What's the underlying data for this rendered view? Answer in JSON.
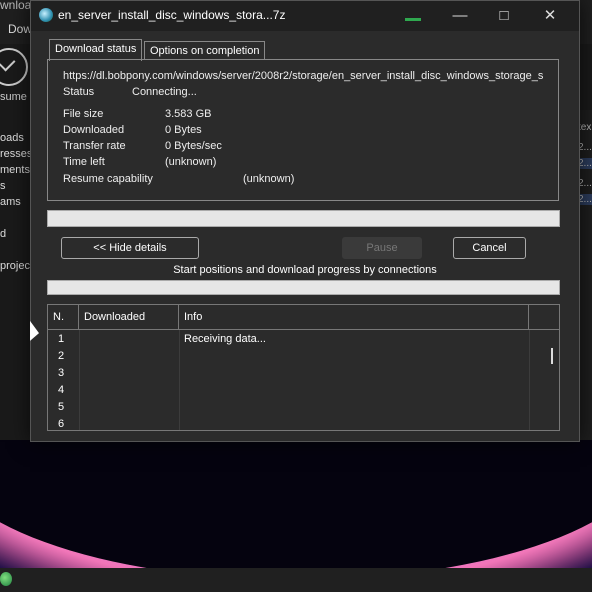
{
  "background_app": {
    "title_fragment": "wnload",
    "menu_fragment": "Dow",
    "resume_label": "sume",
    "categories": [
      "oads",
      "resses",
      "ments",
      "s",
      "ams",
      "d",
      "projec"
    ],
    "right_rows": [
      "tex",
      "2...",
      "2...",
      "2...",
      "2..."
    ]
  },
  "dialog": {
    "title": "en_server_install_disc_windows_stora...7z",
    "tabs": [
      "Download status",
      "Options on completion"
    ],
    "url": "https://dl.bobpony.com/windows/server/2008r2/storage/en_server_install_disc_windows_storage_s",
    "status_label": "Status",
    "status_value": "Connecting...",
    "file_size_label": "File size",
    "file_size_value": "3.583  GB",
    "downloaded_label": "Downloaded",
    "downloaded_value": "0 Bytes",
    "transfer_rate_label": "Transfer rate",
    "transfer_rate_value": "0  Bytes/sec",
    "time_left_label": "Time left",
    "time_left_value": "(unknown)",
    "resume_label": "Resume capability",
    "resume_value": "(unknown)",
    "progress": 0,
    "buttons": {
      "hide_details": "<< Hide details",
      "pause": "Pause",
      "cancel": "Cancel"
    },
    "connections_caption": "Start positions and download progress by connections",
    "table": {
      "headers": [
        "N.",
        "Downloaded",
        "Info"
      ],
      "rows": [
        {
          "n": "1",
          "info": "Receiving data..."
        },
        {
          "n": "2",
          "info": ""
        },
        {
          "n": "3",
          "info": ""
        },
        {
          "n": "4",
          "info": ""
        },
        {
          "n": "5",
          "info": ""
        },
        {
          "n": "6",
          "info": ""
        }
      ]
    }
  },
  "colors": {
    "dialog_bg": "#2b2b2b",
    "titlebar_bg": "#202020",
    "progress_bar": "#e6e6e6"
  }
}
